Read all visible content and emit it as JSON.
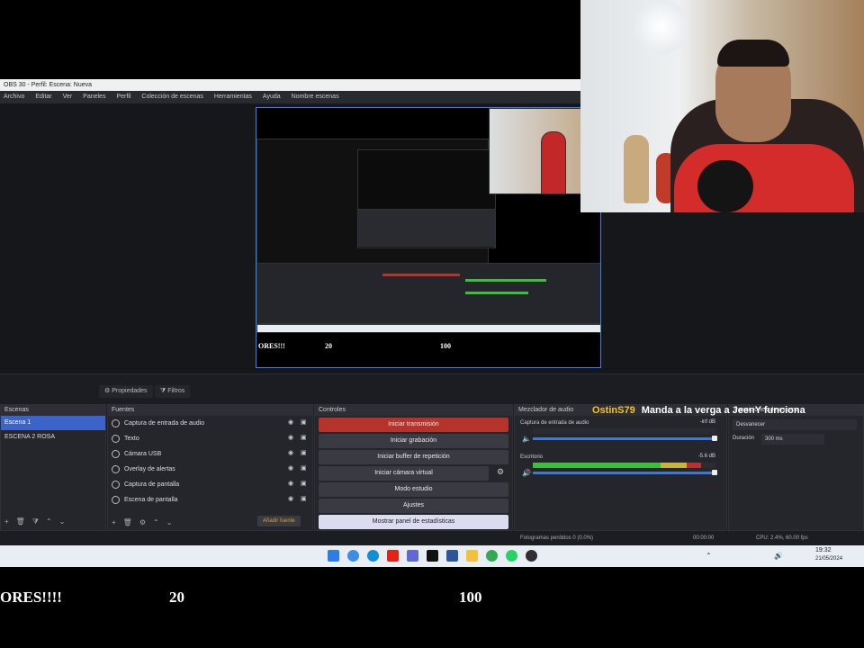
{
  "window": {
    "title": "OBS 30 - Perfil: Escena: Nueva",
    "menu": [
      "Archivo",
      "Editar",
      "Ver",
      "Paneles",
      "Perfil",
      "Colección de escenas",
      "Herramientas",
      "Ayuda",
      "Nombre escenas"
    ]
  },
  "toolbar": {
    "properties_label": "Propiedades",
    "filters_label": "Filtros"
  },
  "scenes": {
    "header": "Escenas",
    "items": [
      "Escena 1",
      "ESCENA 2 ROSA"
    ]
  },
  "sources": {
    "header": "Fuentes",
    "items": [
      "Captura de entrada de audio",
      "Texto",
      "Cámara USB",
      "Overlay de alertas",
      "Captura de pantalla",
      "Escena de pantalla"
    ],
    "add_button_label": "Añadir fuente"
  },
  "controls": {
    "header": "Controles",
    "buttons": [
      "Iniciar transmisión",
      "Iniciar grabación",
      "Iniciar buffer de repetición",
      "Iniciar cámara virtual",
      "Modo estudio",
      "Ajustes",
      "Mostrar panel de estadísticas"
    ]
  },
  "mixer": {
    "header": "Mezclador de audio",
    "tracks": [
      {
        "name": "Captura de entrada de audio",
        "level": "-inf dB"
      },
      {
        "name": "Escritorio",
        "level": "-5.6 dB"
      }
    ]
  },
  "transitions": {
    "header": "Transiciones de escena",
    "type": "Desvanecer",
    "duration_label": "Duración",
    "duration_value": "300 ms"
  },
  "chat": {
    "username": "OstinS79",
    "message": "Manda a la verga a JeenY funciona",
    "username_color": "#f5c518"
  },
  "statusbar": {
    "text": "Fotogramas perdidos 0 (0.0%)",
    "time": "00:00:00",
    "cpu": "CPU: 2.4%, 60.00 fps"
  },
  "taskbar": {
    "clock_time": "19:32",
    "clock_date": "21/05/2024"
  },
  "overlay": {
    "text1": "ORES!!!!",
    "number1": "20",
    "number2": "100",
    "mini_text1": "ORES!!!",
    "mini_number1": "20",
    "mini_number2": "100"
  },
  "colors": {
    "accent_blue": "#3b7ff2",
    "record_red": "#b5332a"
  }
}
